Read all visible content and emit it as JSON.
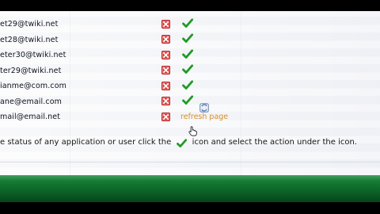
{
  "users": {
    "rows": [
      {
        "email": "et29@twiki.net",
        "show_check": true,
        "delete_icon": "delete-icon",
        "status_icon": "check-icon"
      },
      {
        "email": "et28@twiki.net",
        "show_check": true,
        "delete_icon": "delete-icon",
        "status_icon": "check-icon"
      },
      {
        "email": "eter30@twiki.net",
        "show_check": true,
        "delete_icon": "delete-icon",
        "status_icon": "check-icon"
      },
      {
        "email": "ter29@twiki.net",
        "show_check": true,
        "delete_icon": "delete-icon",
        "status_icon": "check-icon"
      },
      {
        "email": "ianme@com.com",
        "show_check": true,
        "delete_icon": "delete-icon",
        "status_icon": "check-icon"
      },
      {
        "email": "ane@email.com",
        "show_check": true,
        "delete_icon": "delete-icon",
        "status_icon": "check-icon"
      },
      {
        "email": "mail@email.net",
        "show_check": false,
        "delete_icon": "delete-icon",
        "status_icon": ""
      }
    ]
  },
  "refresh": {
    "label": "refresh page",
    "icon": "refresh-icon"
  },
  "instruction": {
    "before": "e status of any application or user click the",
    "after": "icon and select the action under the icon.",
    "icon": "check-icon"
  },
  "pointer": {
    "icon": "hand-pointer-icon"
  },
  "colors": {
    "delete_icon": "#d62f2f",
    "check_icon": "#1f9b24",
    "refresh_text": "#d58f2a",
    "bottom_band": "#0f6d2d"
  }
}
